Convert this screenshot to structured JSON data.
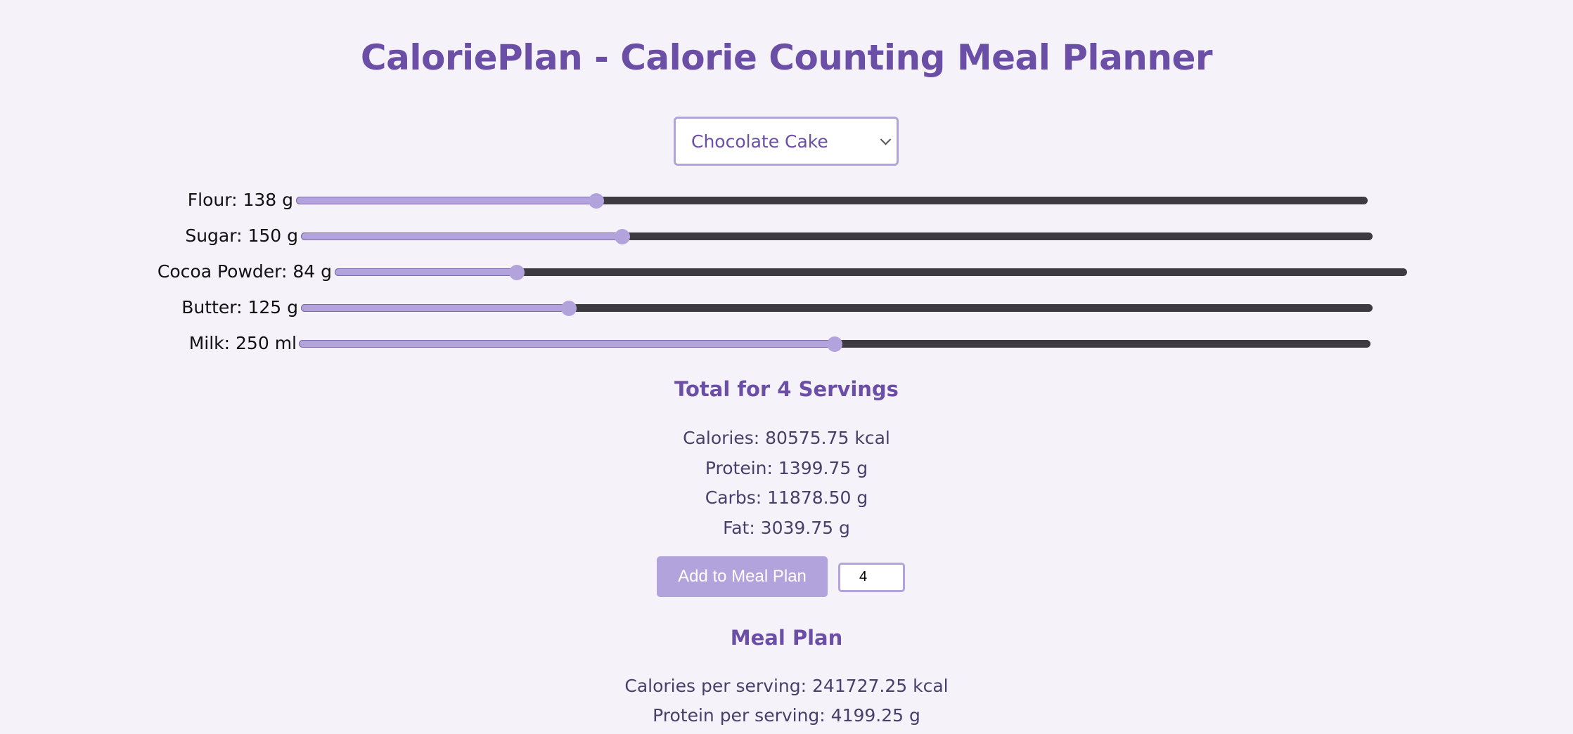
{
  "header": {
    "title": "CaloriePlan - Calorie Counting Meal Planner"
  },
  "recipe_select": {
    "selected": "Chocolate Cake"
  },
  "ingredients": [
    {
      "label": "Flour: 138 g",
      "value": 138,
      "fill_fraction": 0.28
    },
    {
      "label": "Sugar: 150 g",
      "value": 150,
      "fill_fraction": 0.3
    },
    {
      "label": "Cocoa Powder: 84 g",
      "value": 84,
      "fill_fraction": 0.17
    },
    {
      "label": "Butter: 125 g",
      "value": 125,
      "fill_fraction": 0.25
    },
    {
      "label": "Milk: 250 ml",
      "value": 250,
      "fill_fraction": 0.5
    }
  ],
  "totals": {
    "heading": "Total for 4 Servings",
    "calories": "Calories: 80575.75 kcal",
    "protein": "Protein: 1399.75 g",
    "carbs": "Carbs: 11878.50 g",
    "fat": "Fat: 3039.75 g"
  },
  "actions": {
    "add_label": "Add to Meal Plan",
    "servings_value": "4"
  },
  "meal_plan": {
    "heading": "Meal Plan",
    "calories_per_serving": "Calories per serving: 241727.25 kcal",
    "protein_per_serving": "Protein per serving: 4199.25 g"
  },
  "colors": {
    "accent": "#6b4fa6",
    "accent_light": "#b3a3dc",
    "background": "#f5f2fa",
    "track": "#3d3b40"
  }
}
